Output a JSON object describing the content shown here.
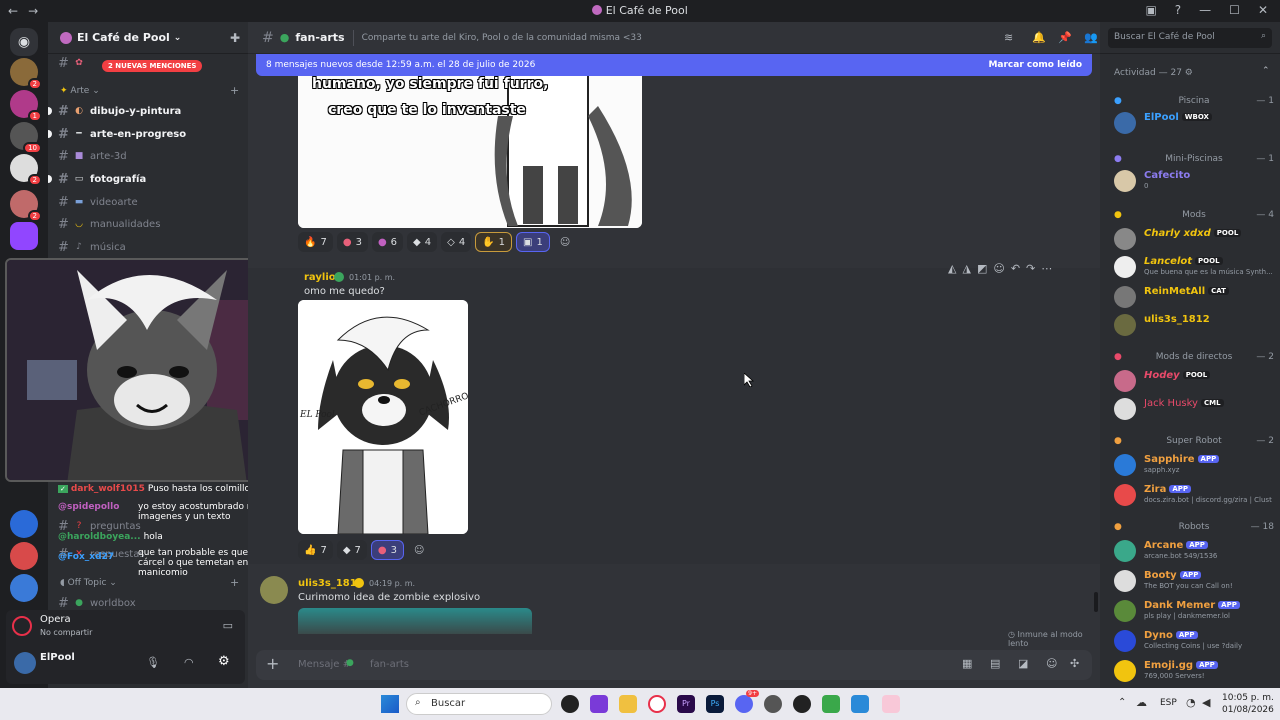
{
  "window": {
    "title": "El Café de Pool",
    "nav_back": "←",
    "nav_fwd": "→"
  },
  "guild_badges": [
    "2",
    "1",
    "10",
    "2",
    "2"
  ],
  "server": {
    "name": "El Café de Pool",
    "mentions_pill": "2 NUEVAS MENCIONES"
  },
  "channels": {
    "category_arte": "Arte",
    "category_off": "Off Topic",
    "items": [
      {
        "name": "dibujo-y-pintura"
      },
      {
        "name": "arte-en-progreso"
      },
      {
        "name": "arte-3d"
      },
      {
        "name": "fotografía"
      },
      {
        "name": "videoarte"
      },
      {
        "name": "manualidades"
      },
      {
        "name": "música"
      },
      {
        "name": "preguntas"
      },
      {
        "name": "respuestas"
      },
      {
        "name": "worldbox"
      }
    ]
  },
  "stream_chat": [
    {
      "user": "dark_wolf1015",
      "text": "Puso hasta los colmillos"
    },
    {
      "user": "@spidepollo",
      "text": "yo estoy acostumbrado mandar imagenes y un texto"
    },
    {
      "user": "@haroldboyea...",
      "text": "hola"
    },
    {
      "user": "@Fox_xd27",
      "text": "que tan probable es que estés es la cárcel o que temetan en un manicomio"
    }
  ],
  "voice": {
    "title": "Opera",
    "subtitle": "No compartir"
  },
  "user": {
    "name": "ElPool"
  },
  "header": {
    "channel": "fan-arts",
    "topic": "Comparte tu arte del Kiro, Pool o de la comunidad misma <33",
    "search_placeholder": "Buscar El Café de Pool"
  },
  "new_messages": {
    "text": "8 mensajes nuevos desde 12:59 a.m. el 28 de julio de 2026",
    "action": "Marcar como leído"
  },
  "image1_text": {
    "line1": "humano, yo siempre fui furro,",
    "line2": "creo que te lo inventaste"
  },
  "reactions1": [
    "7",
    "3",
    "6",
    "4",
    "4",
    "1",
    "1"
  ],
  "message2": {
    "author": "raylio",
    "time": "01:01 p. m.",
    "text": "omo me quedo?",
    "drawing_label": "CACHORRO",
    "signature": "EL Pool"
  },
  "reactions2": [
    "7",
    "7",
    "3"
  ],
  "message3": {
    "author": "ulis3s_1812",
    "time": "04:19 p. m.",
    "text": "Curimomo idea de zombie explosivo"
  },
  "slowmode": "Inmune al modo lento",
  "composer": {
    "placeholder": "Mensaje #",
    "channel": "fan-arts"
  },
  "members": {
    "activity": "Actividad — 27",
    "groups": [
      {
        "name": "Piscina",
        "count": "— 1"
      },
      {
        "name": "Mini-Piscinas",
        "count": "— 1"
      },
      {
        "name": "Mods",
        "count": "— 4"
      },
      {
        "name": "Mods de directos",
        "count": "— 2"
      },
      {
        "name": "Super Robot",
        "count": "— 2"
      },
      {
        "name": "Robots",
        "count": "— 18"
      }
    ],
    "list": [
      {
        "name": "ElPool",
        "tag": "WBOX",
        "sub": "",
        "color": "#3ba0ff"
      },
      {
        "name": "Cafecito",
        "tag": "",
        "sub": "0",
        "color": "#8c7cf0"
      },
      {
        "name": "Charly xdxd",
        "tag": "POOL",
        "sub": "",
        "color": "#f1c40f"
      },
      {
        "name": "Lancelot",
        "tag": "POOL",
        "sub": "Que buena que es la música Synth...",
        "color": "#f1c40f"
      },
      {
        "name": "ReinMetAll",
        "tag": "CAT",
        "sub": "",
        "color": "#f1c40f"
      },
      {
        "name": "ulis3s_1812",
        "tag": "",
        "sub": "",
        "color": "#f1c40f"
      },
      {
        "name": "Hodey",
        "tag": "POOL",
        "sub": "",
        "color": "#e84a6a"
      },
      {
        "name": "Jack Husky",
        "tag": "CML",
        "sub": "",
        "color": "#e84a6a"
      },
      {
        "name": "Sapphire",
        "tag": "APP",
        "sub": "sapph.xyz",
        "color": "#f0a040"
      },
      {
        "name": "Zira",
        "tag": "APP",
        "sub": "docs.zira.bot | discord.gg/zira | Clust",
        "color": "#f0a040"
      },
      {
        "name": "Arcane",
        "tag": "APP",
        "sub": "arcane.bot 549/1536",
        "color": "#f0a040"
      },
      {
        "name": "Booty",
        "tag": "APP",
        "sub": "The BOT you can Call on!",
        "color": "#f0a040"
      },
      {
        "name": "Dank Memer",
        "tag": "APP",
        "sub": "pls play | dankmemer.lol",
        "color": "#f0a040"
      },
      {
        "name": "Dyno",
        "tag": "APP",
        "sub": "Collecting Coins | use ?daily",
        "color": "#f0a040"
      },
      {
        "name": "Emoji.gg",
        "tag": "APP",
        "sub": "769,000 Servers!",
        "color": "#f0a040"
      }
    ]
  },
  "taskbar": {
    "search": "Buscar",
    "lang": "ESP",
    "time": "10:05 p. m.",
    "date": "01/08/2026",
    "discord_badge": "9+"
  }
}
